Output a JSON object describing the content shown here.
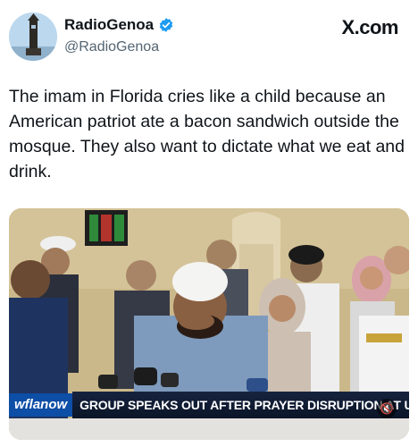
{
  "author": {
    "display_name": "RadioGenoa",
    "handle": "@RadioGenoa",
    "verified_icon": "verified-badge-icon",
    "avatar_icon": "tower-avatar"
  },
  "brand": "X.com",
  "tweet": {
    "text": "The imam in Florida cries like a child because an American patriot ate a bacon sandwich outside the mosque. They also want to dictate what we eat and drink."
  },
  "media": {
    "station": "wflanow",
    "headline": "GROUP SPEAKS OUT AFTER PRAYER DISRUPTION AT USF",
    "mute_icon": "speaker-muted-icon"
  },
  "colors": {
    "accent_blue": "#1d9bf0",
    "text": "#0f1419",
    "muted": "#536471",
    "news_bar": "#0b1528",
    "news_chip": "#0d4ea6"
  }
}
